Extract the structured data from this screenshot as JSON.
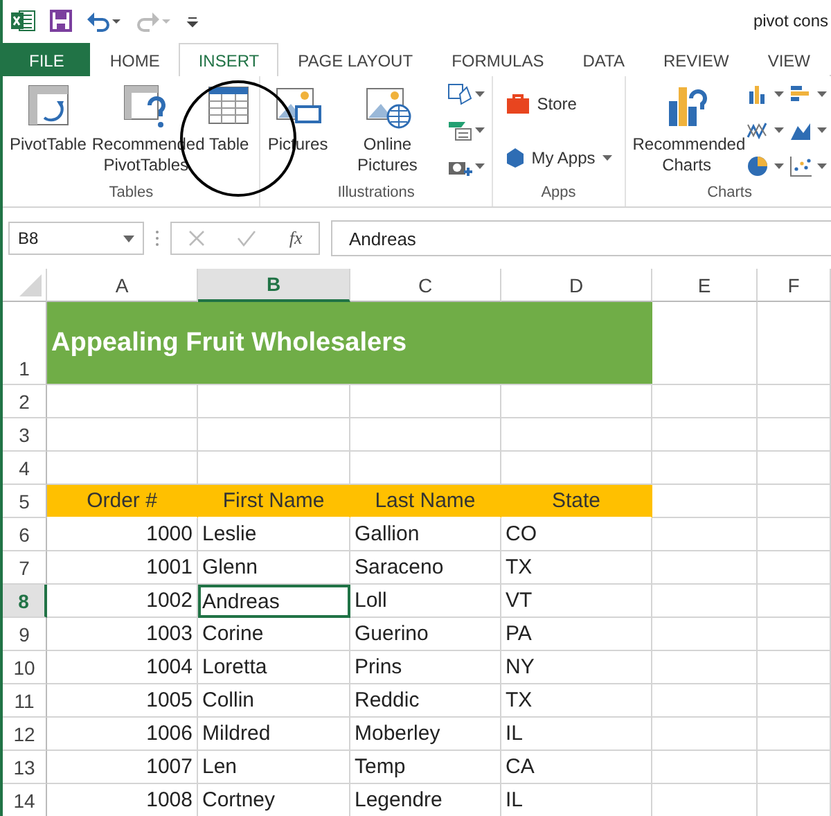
{
  "title_bar": {
    "title": "pivot cons"
  },
  "tabs": [
    {
      "label": "FILE",
      "kind": "file",
      "selected": false
    },
    {
      "label": "HOME",
      "kind": "tab",
      "selected": false
    },
    {
      "label": "INSERT",
      "kind": "tab",
      "selected": true
    },
    {
      "label": "PAGE LAYOUT",
      "kind": "tab",
      "selected": false
    },
    {
      "label": "FORMULAS",
      "kind": "tab",
      "selected": false
    },
    {
      "label": "DATA",
      "kind": "tab",
      "selected": false
    },
    {
      "label": "REVIEW",
      "kind": "tab",
      "selected": false
    },
    {
      "label": "VIEW",
      "kind": "tab",
      "selected": false
    }
  ],
  "ribbon_groups": [
    {
      "label": "Tables",
      "items": [
        {
          "kind": "pivot",
          "label": "PivotTable"
        },
        {
          "kind": "recpivot",
          "label": "Recommended PivotTables"
        },
        {
          "kind": "table",
          "label": "Table"
        }
      ]
    },
    {
      "label": "Illustrations",
      "items": [
        {
          "kind": "pictures",
          "label": "Pictures"
        },
        {
          "kind": "online",
          "label": "Online Pictures"
        },
        {
          "kind": "shapes"
        },
        {
          "kind": "smartart"
        },
        {
          "kind": "screenshot"
        }
      ]
    },
    {
      "label": "Apps",
      "items": [
        {
          "kind": "store",
          "label": "Store"
        },
        {
          "kind": "myapps",
          "label": "My Apps"
        }
      ]
    },
    {
      "label": "Charts",
      "items": [
        {
          "kind": "reccharts",
          "label": "Recommended Charts"
        },
        {
          "kind": "column"
        },
        {
          "kind": "line"
        },
        {
          "kind": "pie"
        },
        {
          "kind": "bar"
        },
        {
          "kind": "area"
        },
        {
          "kind": "scatter"
        }
      ]
    }
  ],
  "formula_bar": {
    "name_box": "B8",
    "function_label": "fx",
    "value": "Andreas"
  },
  "columns": [
    {
      "label": "A",
      "selected": false
    },
    {
      "label": "B",
      "selected": true
    },
    {
      "label": "C",
      "selected": false
    },
    {
      "label": "D",
      "selected": false
    },
    {
      "label": "E",
      "selected": false
    },
    {
      "label": "F",
      "selected": false
    }
  ],
  "rows": [
    {
      "number": "1",
      "kind": "title",
      "selected": false,
      "cells": [
        "Appealing Fruit Wholesalers"
      ]
    },
    {
      "number": "2",
      "kind": "blank",
      "selected": false,
      "cells": []
    },
    {
      "number": "3",
      "kind": "blank",
      "selected": false,
      "cells": []
    },
    {
      "number": "4",
      "kind": "blank",
      "selected": false,
      "cells": []
    },
    {
      "number": "5",
      "kind": "header",
      "selected": false,
      "cells": [
        "Order #",
        "First Name",
        "Last Name",
        "State"
      ]
    },
    {
      "number": "6",
      "kind": "data",
      "selected": false,
      "cells": [
        "1000",
        "Leslie",
        "Gallion",
        "CO"
      ]
    },
    {
      "number": "7",
      "kind": "data",
      "selected": false,
      "cells": [
        "1001",
        "Glenn",
        "Saraceno",
        "TX"
      ]
    },
    {
      "number": "8",
      "kind": "data",
      "selected": true,
      "cells": [
        "1002",
        "Andreas",
        "Loll",
        "VT"
      ]
    },
    {
      "number": "9",
      "kind": "data",
      "selected": false,
      "cells": [
        "1003",
        "Corine",
        "Guerino",
        "PA"
      ]
    },
    {
      "number": "10",
      "kind": "data",
      "selected": false,
      "cells": [
        "1004",
        "Loretta",
        "Prins",
        "NY"
      ]
    },
    {
      "number": "11",
      "kind": "data",
      "selected": false,
      "cells": [
        "1005",
        "Collin",
        "Reddic",
        "TX"
      ]
    },
    {
      "number": "12",
      "kind": "data",
      "selected": false,
      "cells": [
        "1006",
        "Mildred",
        "Moberley",
        "IL"
      ]
    },
    {
      "number": "13",
      "kind": "data",
      "selected": false,
      "cells": [
        "1007",
        "Len",
        "Temp",
        "CA"
      ]
    },
    {
      "number": "14",
      "kind": "data",
      "selected": false,
      "cells": [
        "1008",
        "Cortney",
        "Legendre",
        "IL"
      ]
    }
  ]
}
